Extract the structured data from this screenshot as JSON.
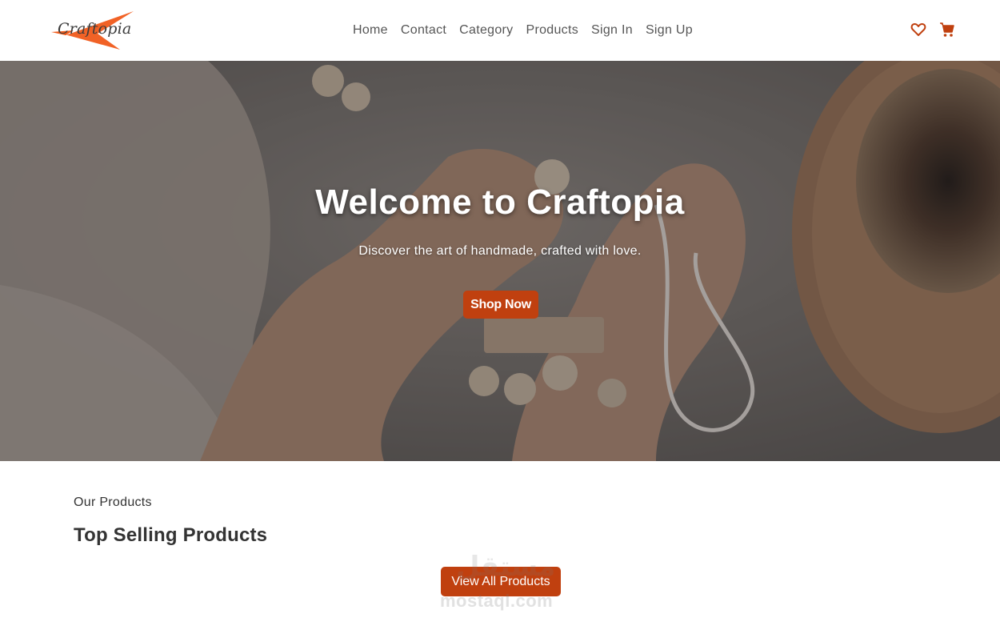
{
  "brand": {
    "name": "Craftopia",
    "accent_color": "#c0400f",
    "logo_accent_color": "#f05a1a"
  },
  "nav": {
    "links": [
      {
        "label": "Home"
      },
      {
        "label": "Contact"
      },
      {
        "label": "Category"
      },
      {
        "label": "Products"
      },
      {
        "label": "Sign In"
      },
      {
        "label": "Sign Up"
      }
    ],
    "icons": [
      "heart-icon",
      "cart-icon"
    ]
  },
  "hero": {
    "title": "Welcome to Craftopia",
    "subtitle": "Discover the art of handmade, crafted with love.",
    "cta_label": "Shop Now"
  },
  "products_section": {
    "eyebrow": "Our Products",
    "title": "Top Selling Products",
    "view_all_label": "View All Products"
  },
  "watermark": {
    "arabic": "مستقل",
    "latin": "mostaql.com"
  }
}
